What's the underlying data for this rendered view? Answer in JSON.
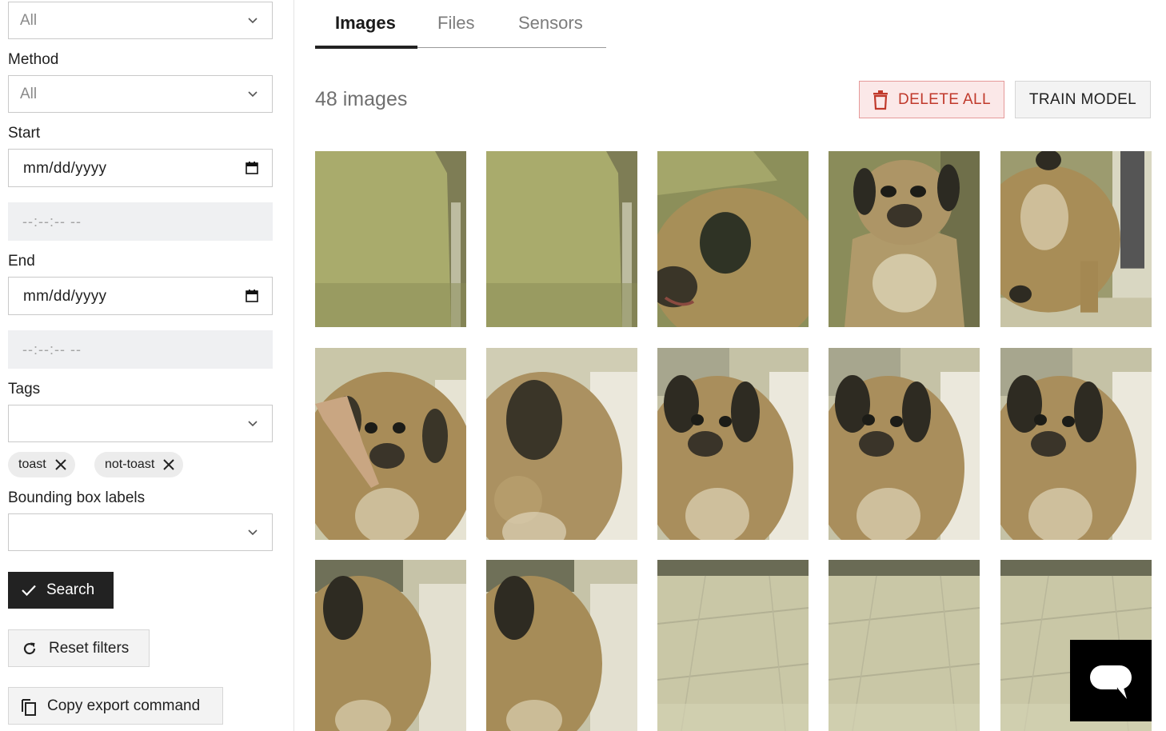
{
  "sidebar": {
    "first_select_value": "All",
    "method": {
      "label": "Method",
      "value": "All"
    },
    "start": {
      "label": "Start",
      "date_placeholder": "mm/dd/yyyy",
      "time_placeholder": "--:--:-- --"
    },
    "end": {
      "label": "End",
      "date_placeholder": "mm/dd/yyyy",
      "time_placeholder": "--:--:-- --"
    },
    "tags": {
      "label": "Tags",
      "value": "",
      "chips": [
        "toast",
        "not-toast"
      ]
    },
    "bbox_labels": {
      "label": "Bounding box labels",
      "value": ""
    },
    "search_label": "Search",
    "reset_label": "Reset filters",
    "copy_label": "Copy export command"
  },
  "main": {
    "tabs": [
      {
        "label": "Images",
        "active": true
      },
      {
        "label": "Files",
        "active": false
      },
      {
        "label": "Sensors",
        "active": false
      }
    ],
    "count_label": "48 images",
    "delete_label": "DELETE ALL",
    "train_label": "TRAIN MODEL",
    "thumbnails": [
      "green-chair",
      "green-chair",
      "dog-head-top",
      "dog-front",
      "dog-side",
      "dog-hand",
      "dog-head-down",
      "dog-face",
      "dog-face",
      "dog-face",
      "dog-side-close",
      "dog-side-close",
      "floor",
      "floor",
      "floor"
    ]
  },
  "icons": {
    "chevron": "chevron-down-icon",
    "calendar": "calendar-icon",
    "close": "close-icon",
    "check": "check-icon",
    "refresh": "refresh-icon",
    "copy": "copy-icon",
    "trash": "trash-icon",
    "chat": "chat-icon"
  },
  "colors": {
    "danger": "#c0392b",
    "danger_bg": "#fbe8e8",
    "primary": "#222222"
  }
}
